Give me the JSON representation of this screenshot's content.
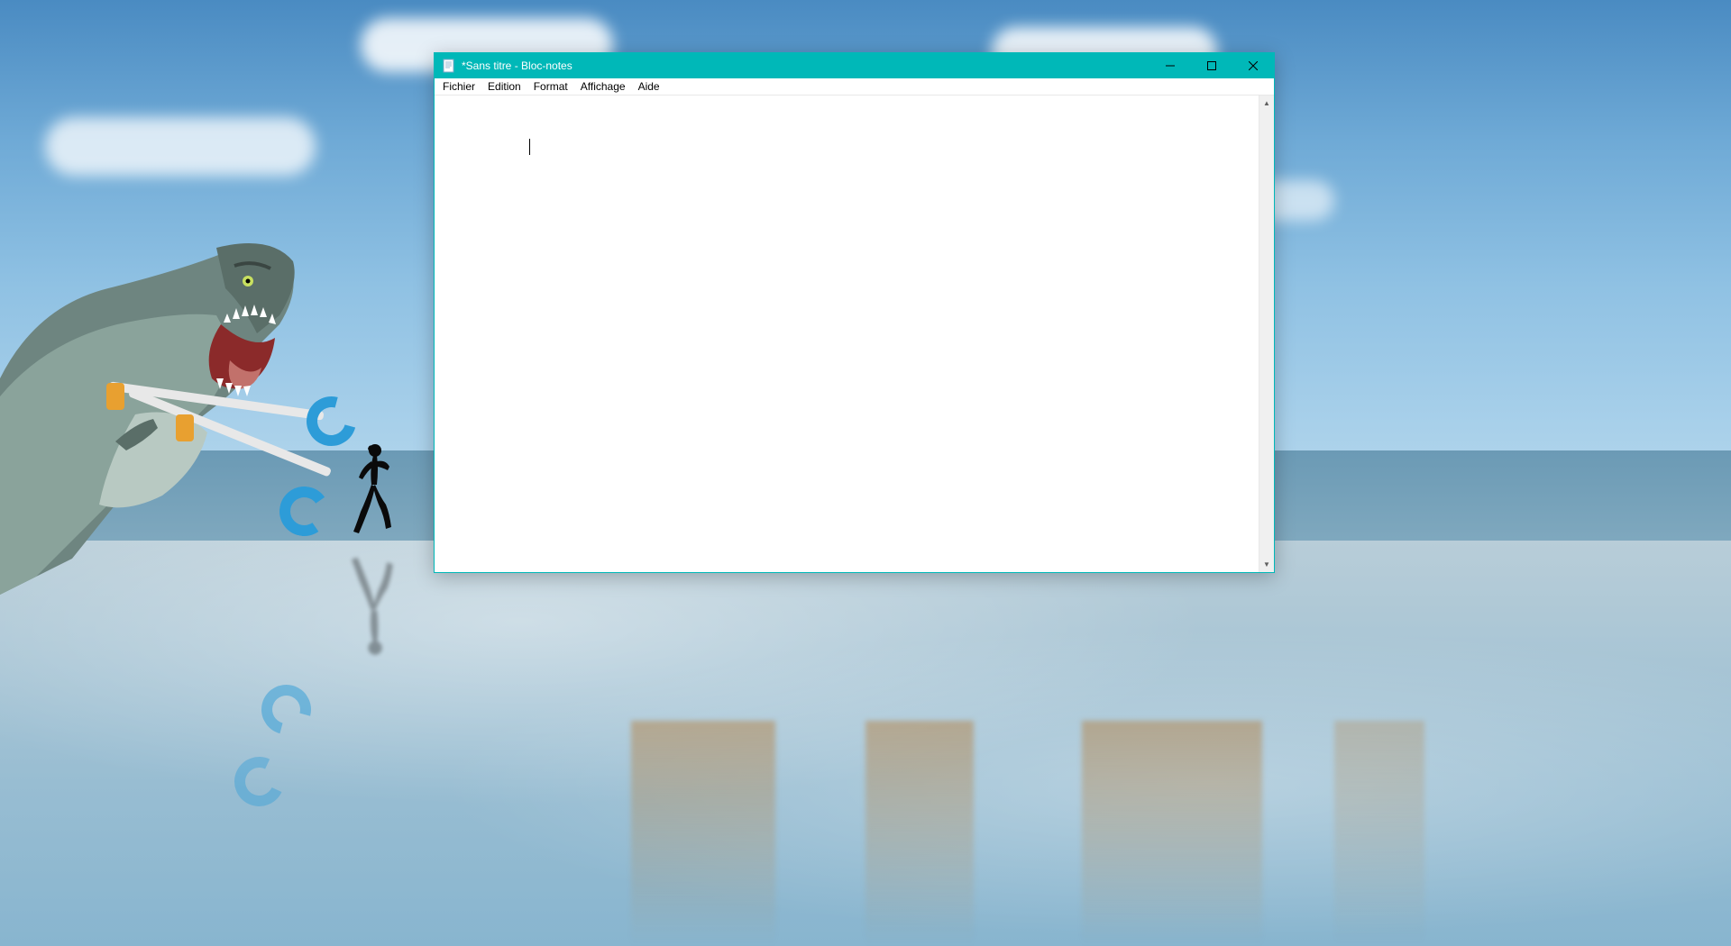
{
  "window": {
    "title": "*Sans titre - Bloc-notes",
    "app_icon": "notepad-icon",
    "accent_color": "#00b8b8"
  },
  "menubar": {
    "items": [
      "Fichier",
      "Edition",
      "Format",
      "Affichage",
      "Aide"
    ]
  },
  "editor": {
    "content": ""
  }
}
